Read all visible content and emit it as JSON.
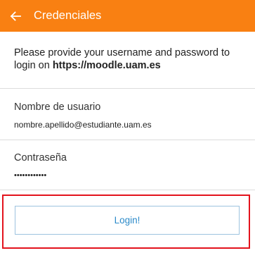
{
  "header": {
    "back_icon": "arrow-left-icon",
    "title": "Credenciales",
    "color": "#f98012"
  },
  "prompt": {
    "text": "Please provide your username and password to login on ",
    "host": "https://moodle.uam.es"
  },
  "username": {
    "label": "Nombre de usuario",
    "value": "nombre.apellido@estudiante.uam.es"
  },
  "password": {
    "label": "Contraseña",
    "value": "••••••••••••"
  },
  "login_button": {
    "label": "Login!",
    "text_color": "#2b8ac9"
  },
  "highlight_color": "#e3131d"
}
